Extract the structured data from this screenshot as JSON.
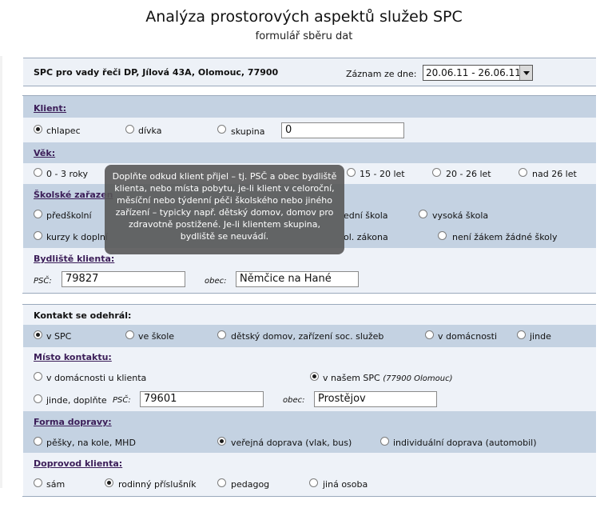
{
  "header": {
    "title": "Analýza prostorových aspektů služeb SPC",
    "subtitle": "formulář sběru dat"
  },
  "center": {
    "name": "SPC pro vady řeči DP, Jílová 43A, Olomouc, 77900",
    "record_label": "Záznam ze dne:",
    "record_value": "20.06.11 - 26.06.11"
  },
  "client": {
    "label": "Klient:",
    "options": [
      "chlapec",
      "dívka",
      "skupina"
    ],
    "selected": "chlapec",
    "group_count": "0"
  },
  "age": {
    "label": "Věk:",
    "options": [
      "0 - 3 roky",
      "15 - 20 let",
      "20 - 26 let",
      "nad 26 let"
    ]
  },
  "school": {
    "label": "Školské zařazen",
    "options": [
      "předškolní",
      "ední škola",
      "vysoká škola",
      "kurzy k doplní",
      "ol. zákona",
      "není žákem žádné školy"
    ]
  },
  "residence": {
    "label": "Bydliště klienta:",
    "psc_label": "PSČ:",
    "psc_value": "79827",
    "obec_label": "obec:",
    "obec_value": "Němčice na Hané"
  },
  "tooltip": {
    "text": "Doplňte odkud klient přijel – tj. PSČ a obec bydliště klienta, nebo místa pobytu, je-li klient v celoroční, měsíční nebo týdenní péči školského nebo jiného zařízení – typicky např. dětský domov, domov pro zdravotně postižené. Je-li klientem skupina, bydliště se neuvádí."
  },
  "contact": {
    "label": "Kontakt se odehrál:",
    "options": [
      "v SPC",
      "ve škole",
      "dětský domov, zařízení soc. služeb",
      "v domácnosti",
      "jinde"
    ],
    "selected": "v SPC"
  },
  "place": {
    "label": "Místo kontaktu:",
    "opt_home": "v domácnosti u klienta",
    "opt_spc": "v našem SPC",
    "opt_spc_note": "(77900 Olomouc)",
    "opt_else": "jinde, doplňte",
    "psc_label": "PSČ:",
    "psc_value": "79601",
    "obec_label": "obec:",
    "obec_value": "Prostějov",
    "selected": "v našem SPC"
  },
  "transport": {
    "label": "Forma dopravy:",
    "options": [
      "pěšky, na kole, MHD",
      "veřejná doprava (vlak, bus)",
      "individuální doprava (automobil)"
    ],
    "selected": "veřejná doprava (vlak, bus)"
  },
  "escort": {
    "label": "Doprovod klienta:",
    "options": [
      "sám",
      "rodinný příslušník",
      "pedagog",
      "jiná osoba"
    ],
    "selected": "rodinný příslušník"
  },
  "colors": {
    "band_dark": "#c4d2e2",
    "band_light": "#eef2f8",
    "label_purple": "#3b1d58",
    "tooltip_bg": "#585858"
  }
}
